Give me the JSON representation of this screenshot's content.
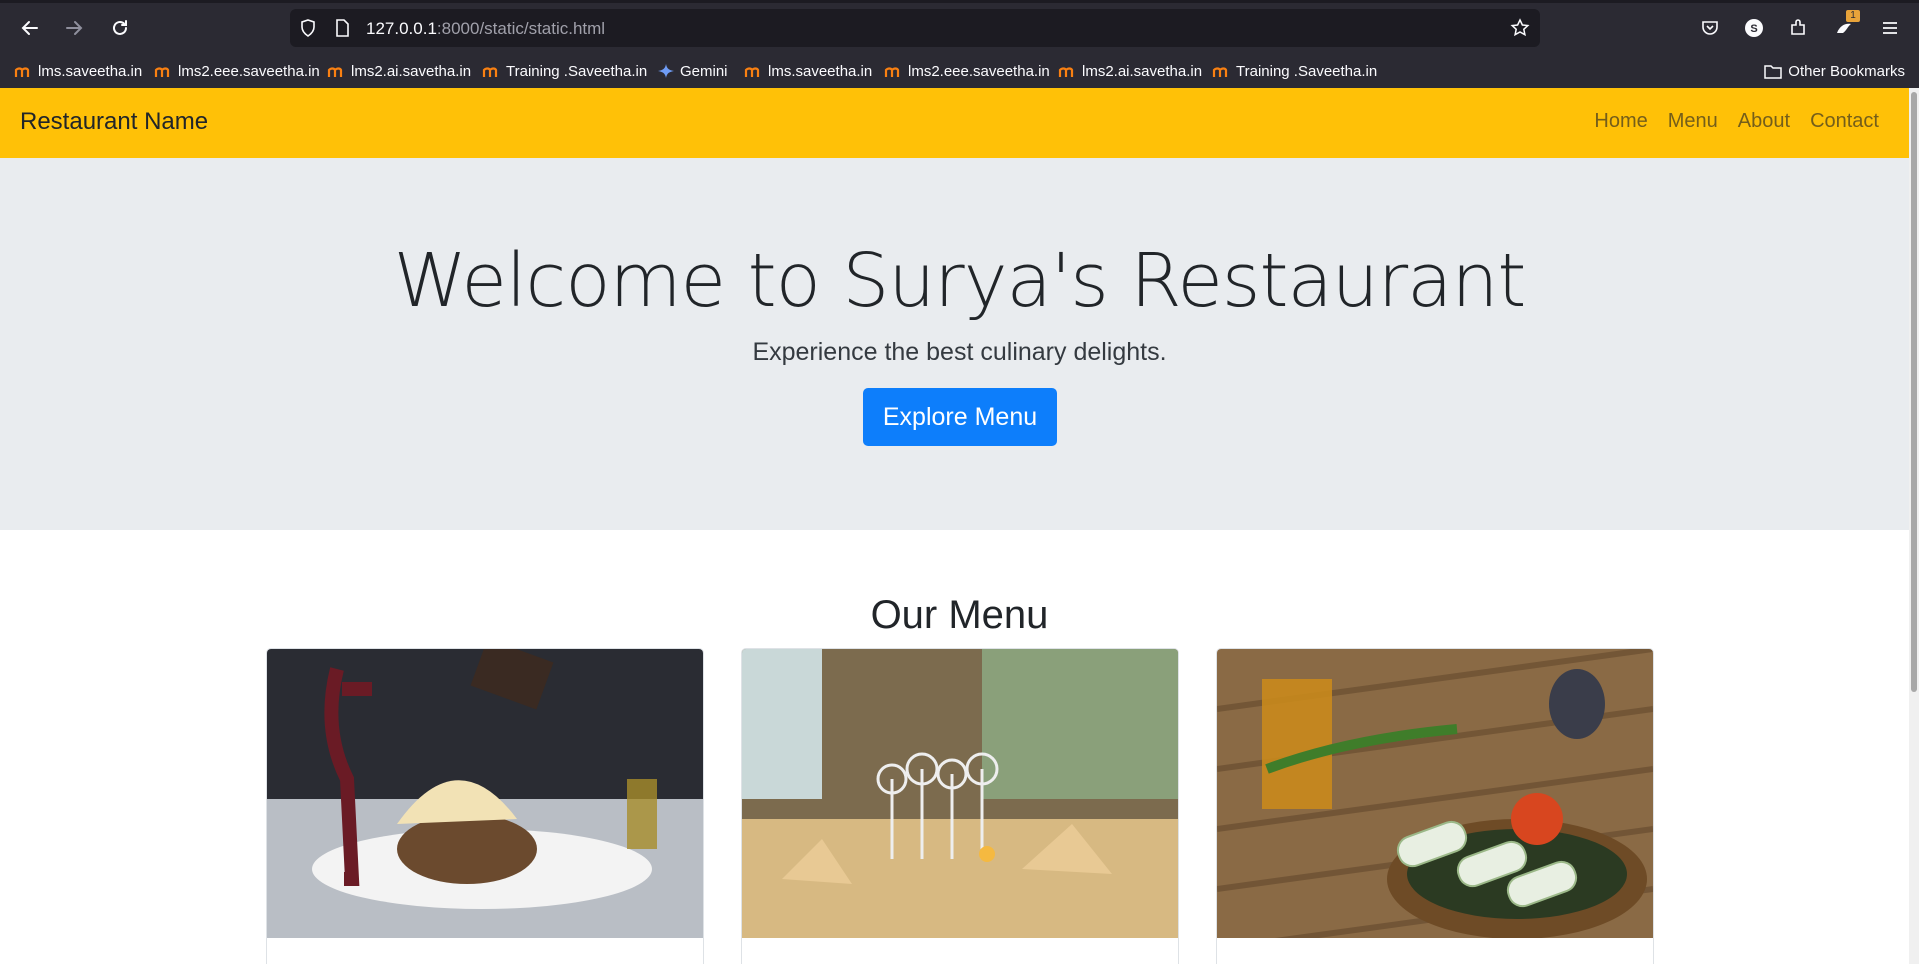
{
  "browser": {
    "url_host": "127.0.0.1",
    "url_rest": ":8000/static/static.html",
    "extensions_badge": "1",
    "bookmarks": [
      "lms.saveetha.in",
      "lms2.eee.saveetha.in",
      "lms2.ai.savetha.in",
      "Training .Saveetha.in",
      "Gemini",
      "lms.saveetha.in",
      "lms2.eee.saveetha.in",
      "lms2.ai.savetha.in",
      "Training .Saveetha.in"
    ],
    "other_bookmarks": "Other Bookmarks"
  },
  "navbar": {
    "brand": "Restaurant Name",
    "links": [
      "Home",
      "Menu",
      "About",
      "Contact"
    ]
  },
  "hero": {
    "title": "Welcome to Surya's Restaurant",
    "subtitle": "Experience the best culinary delights.",
    "button": "Explore Menu"
  },
  "menu": {
    "title": "Our Menu"
  },
  "colors": {
    "navbar": "#ffc107",
    "hero_bg": "#e9ecef",
    "primary": "#0d7efb",
    "chrome": "#2b2a33"
  }
}
